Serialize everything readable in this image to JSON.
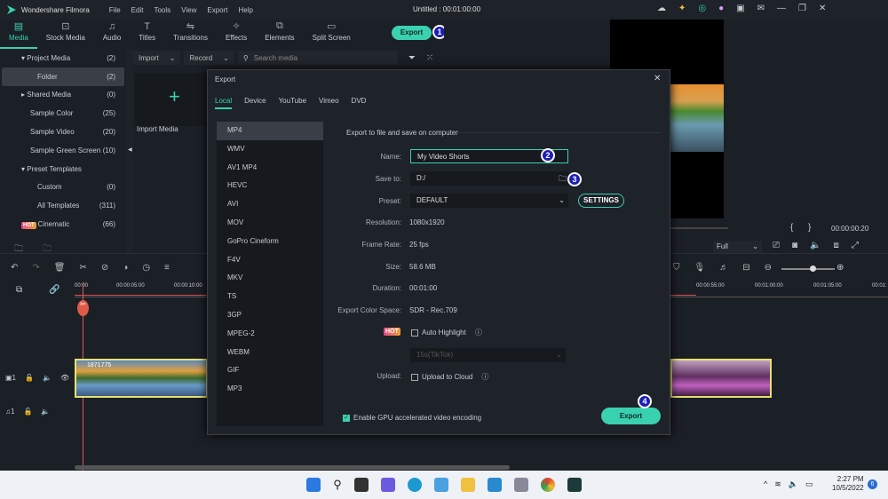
{
  "app": {
    "title": "Wondershare Filmora",
    "project": "Untitled : 00:01:00:00",
    "menu": [
      "File",
      "Edit",
      "Tools",
      "View",
      "Export",
      "Help"
    ]
  },
  "toolbar": {
    "tabs": [
      {
        "label": "Media",
        "icon": "folder-icon"
      },
      {
        "label": "Stock Media",
        "icon": "image-icon"
      },
      {
        "label": "Audio",
        "icon": "music-icon"
      },
      {
        "label": "Titles",
        "icon": "text-icon"
      },
      {
        "label": "Transitions",
        "icon": "transition-icon"
      },
      {
        "label": "Effects",
        "icon": "effects-icon"
      },
      {
        "label": "Elements",
        "icon": "elements-icon"
      },
      {
        "label": "Split Screen",
        "icon": "split-screen-icon"
      }
    ],
    "export_label": "Export"
  },
  "steps": [
    "1",
    "2",
    "3",
    "4"
  ],
  "sidebar": {
    "items": [
      {
        "label": "Project Media",
        "count": "(2)"
      },
      {
        "label": "Folder",
        "count": "(2)"
      },
      {
        "label": "Shared Media",
        "count": "(0)"
      },
      {
        "label": "Sample Color",
        "count": "(25)"
      },
      {
        "label": "Sample Video",
        "count": "(20)"
      },
      {
        "label": "Sample Green Screen",
        "count": "(10)"
      },
      {
        "label": "Preset Templates",
        "count": ""
      },
      {
        "label": "Custom",
        "count": "(0)"
      },
      {
        "label": "All Templates",
        "count": "(311)"
      },
      {
        "label": "Cinematic",
        "count": "(66)",
        "badge": "HOT"
      }
    ]
  },
  "media": {
    "import": "Import",
    "record": "Record",
    "search_placeholder": "Search media",
    "import_media": "Import Media"
  },
  "preview": {
    "timecode": "00:00:00:20",
    "zoom": "Full"
  },
  "timeline": {
    "ruler": [
      "00:00",
      "00:00:05:00",
      "00:00:10:00",
      "00:00:55:00",
      "00:01:00:00",
      "00:01:05:00",
      "00:01:"
    ],
    "clip_name": "1871775"
  },
  "dialog": {
    "title": "Export",
    "tabs": [
      "Local",
      "Device",
      "YouTube",
      "Vimeo",
      "DVD"
    ],
    "formats": [
      "MP4",
      "WMV",
      "AV1 MP4",
      "HEVC",
      "AVI",
      "MOV",
      "GoPro Cineform",
      "F4V",
      "MKV",
      "TS",
      "3GP",
      "MPEG-2",
      "WEBM",
      "GIF",
      "MP3"
    ],
    "heading": "Export to file and save on computer",
    "name_label": "Name:",
    "name_value": "My Video Shorts",
    "save_label": "Save to:",
    "save_value": "D:/",
    "preset_label": "Preset:",
    "preset_value": "DEFAULT",
    "settings": "SETTINGS",
    "resolution_label": "Resolution:",
    "resolution": "1080x1920",
    "framerate_label": "Frame Rate:",
    "framerate": "25 fps",
    "size_label": "Size:",
    "size": "58.6 MB",
    "duration_label": "Duration:",
    "duration": "00:01:00",
    "colorspace_label": "Export Color Space:",
    "colorspace": "SDR - Rec.709",
    "hot": "HOT",
    "auto_highlight": "Auto Highlight",
    "highlight_select": "15s(TikTok)",
    "upload_label": "Upload:",
    "upload_cloud": "Upload to Cloud",
    "gpu": "Enable GPU accelerated video encoding",
    "export": "Export"
  },
  "taskbar": {
    "time": "2:27 PM",
    "date": "10/5/2022",
    "notifications": "6"
  }
}
